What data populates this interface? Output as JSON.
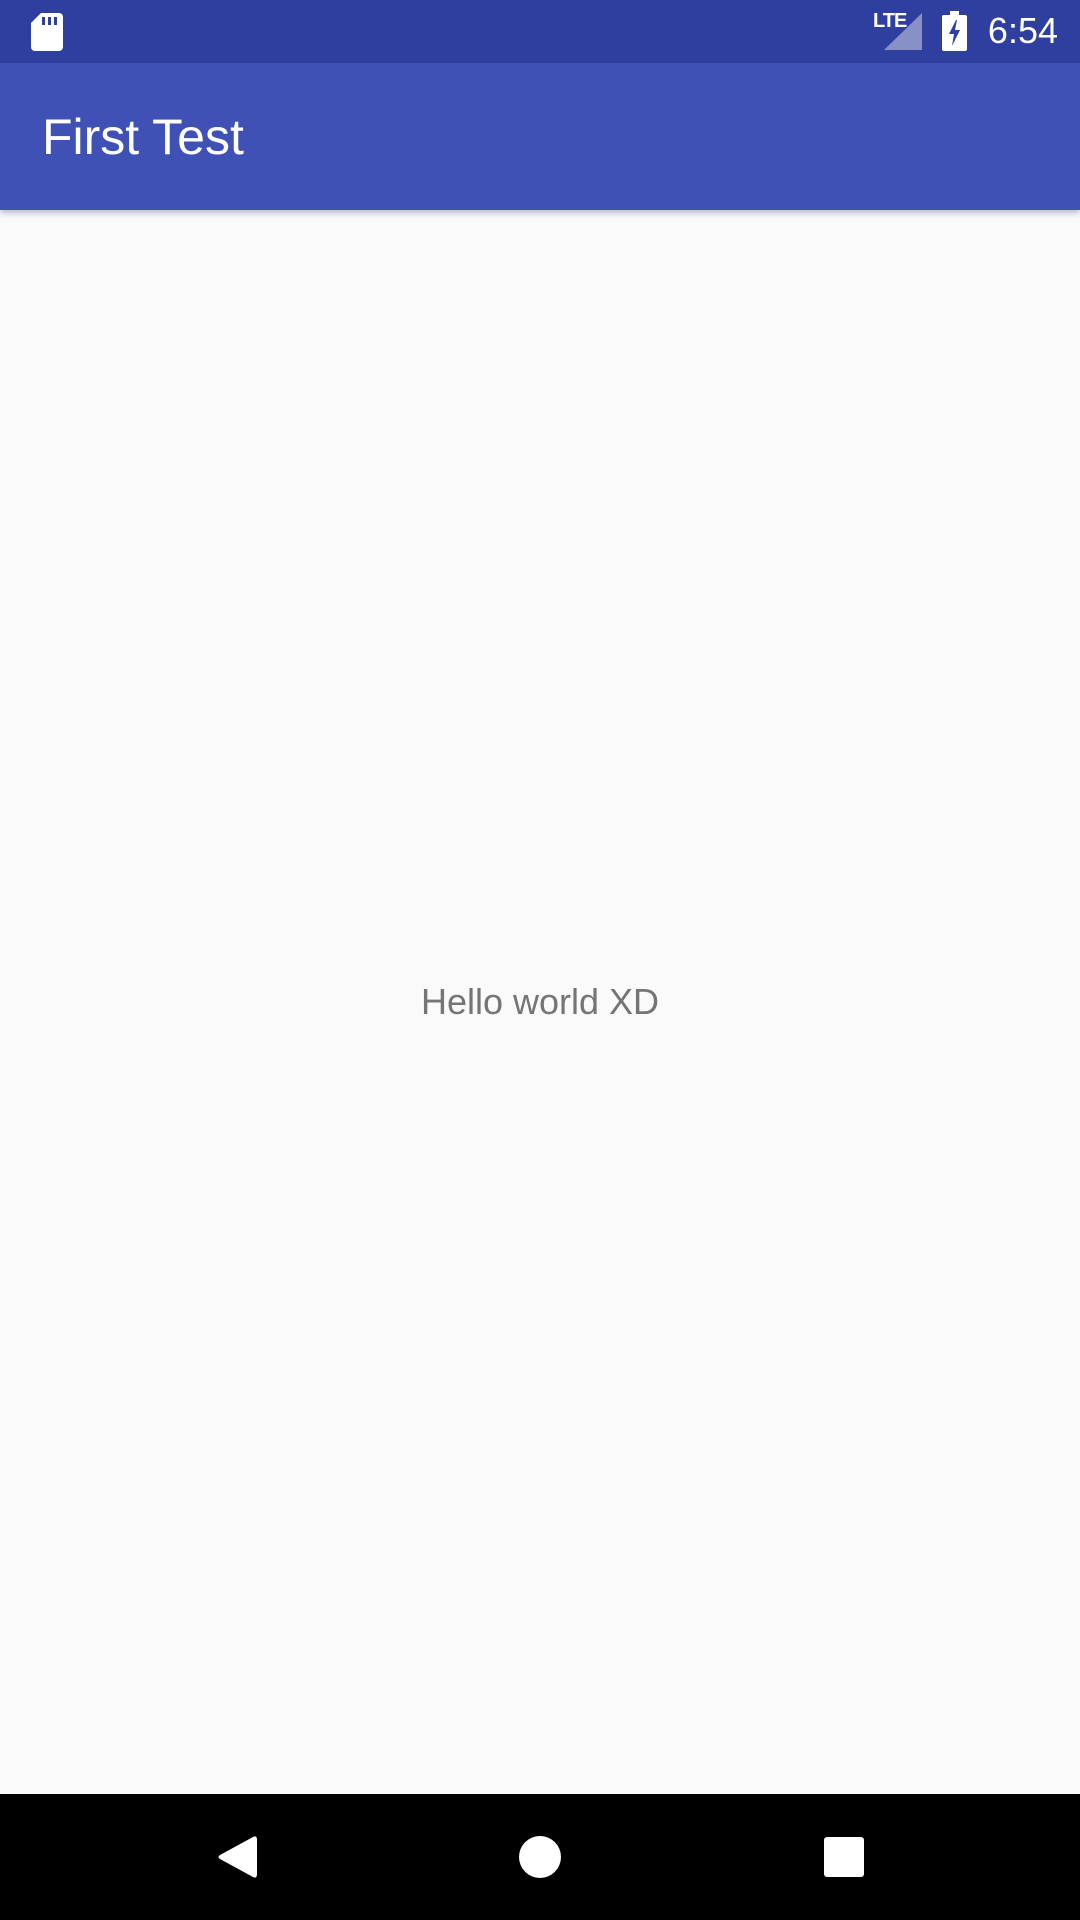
{
  "status_bar": {
    "network_label": "LTE",
    "time": "6:54",
    "icons": [
      "sd-card-icon",
      "signal-icon",
      "battery-charging-icon"
    ]
  },
  "app_bar": {
    "title": "First Test"
  },
  "main": {
    "message": "Hello world XD"
  },
  "nav_bar": {
    "icons": [
      "back-icon",
      "home-icon",
      "recents-icon"
    ]
  },
  "colors": {
    "status_bar": "#2f3f9f",
    "app_bar": "#3f51b5",
    "background": "#fafafa",
    "message_text": "#757575",
    "nav_bar": "#000000"
  }
}
